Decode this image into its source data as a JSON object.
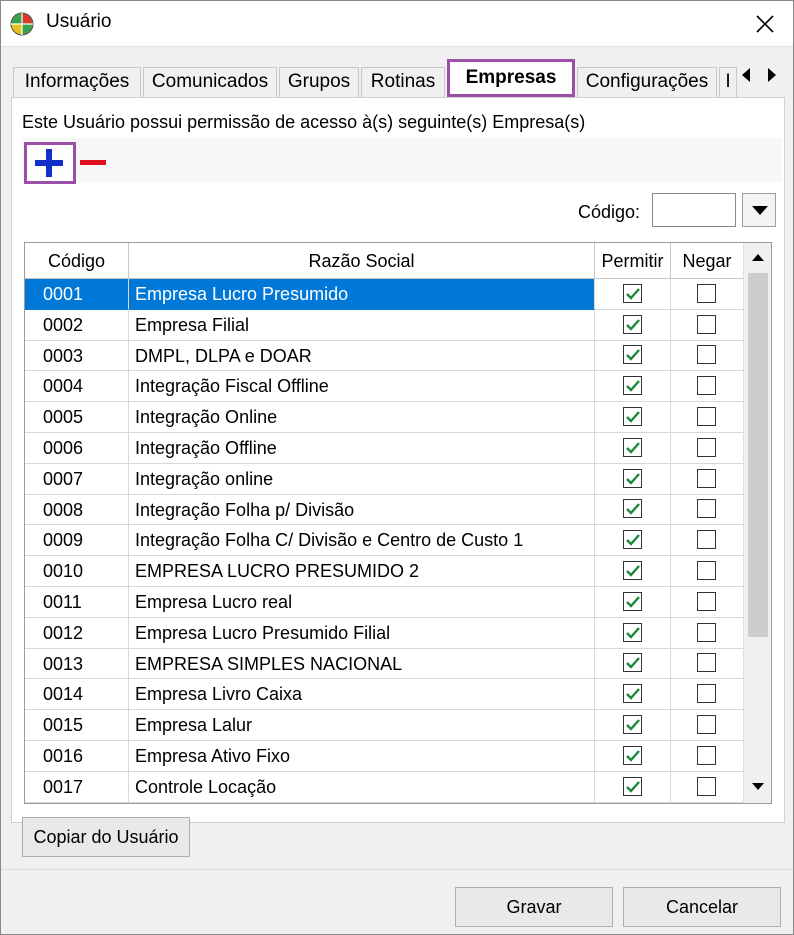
{
  "window": {
    "title": "Usuário",
    "close_icon": "close-icon"
  },
  "tabs": [
    {
      "label": "Informações"
    },
    {
      "label": "Comunicados"
    },
    {
      "label": "Grupos"
    },
    {
      "label": "Rotinas"
    },
    {
      "label": "Empresas",
      "active": true
    },
    {
      "label": "Configurações"
    },
    {
      "label": "I"
    }
  ],
  "panel": {
    "info_text": "Este Usuário possui permissão de acesso à(s) seguinte(s) Empresa(s)",
    "code_label": "Código:",
    "code_value": ""
  },
  "grid": {
    "headers": {
      "code": "Código",
      "name": "Razão Social",
      "permit": "Permitir",
      "deny": "Negar"
    },
    "rows": [
      {
        "code": "0001",
        "name": "Empresa Lucro Presumido",
        "permit": true,
        "deny": false,
        "selected": true
      },
      {
        "code": "0002",
        "name": "Empresa Filial",
        "permit": true,
        "deny": false
      },
      {
        "code": "0003",
        "name": "DMPL, DLPA e DOAR",
        "permit": true,
        "deny": false
      },
      {
        "code": "0004",
        "name": "Integração Fiscal Offline",
        "permit": true,
        "deny": false
      },
      {
        "code": "0005",
        "name": "Integração Online",
        "permit": true,
        "deny": false
      },
      {
        "code": "0006",
        "name": "Integração Offline",
        "permit": true,
        "deny": false
      },
      {
        "code": "0007",
        "name": "Integração online",
        "permit": true,
        "deny": false
      },
      {
        "code": "0008",
        "name": "Integração Folha p/ Divisão",
        "permit": true,
        "deny": false
      },
      {
        "code": "0009",
        "name": "Integração Folha C/ Divisão e Centro de Custo 1",
        "permit": true,
        "deny": false
      },
      {
        "code": "0010",
        "name": "EMPRESA LUCRO PRESUMIDO  2",
        "permit": true,
        "deny": false
      },
      {
        "code": "0011",
        "name": "Empresa Lucro real",
        "permit": true,
        "deny": false
      },
      {
        "code": "0012",
        "name": "Empresa Lucro Presumido Filial",
        "permit": true,
        "deny": false
      },
      {
        "code": "0013",
        "name": "EMPRESA SIMPLES NACIONAL",
        "permit": true,
        "deny": false
      },
      {
        "code": "0014",
        "name": "Empresa Livro Caixa",
        "permit": true,
        "deny": false
      },
      {
        "code": "0015",
        "name": "Empresa Lalur",
        "permit": true,
        "deny": false
      },
      {
        "code": "0016",
        "name": "Empresa Ativo Fixo",
        "permit": true,
        "deny": false
      },
      {
        "code": "0017",
        "name": "Controle Locação",
        "permit": true,
        "deny": false
      }
    ]
  },
  "buttons": {
    "copy": "Copiar do Usuário",
    "save": "Gravar",
    "cancel": "Cancelar"
  },
  "colors": {
    "accent": "#9b4fa6",
    "selection": "#0078d7",
    "add": "#1030c8",
    "remove": "#e01020",
    "check": "#1a8a3a"
  }
}
